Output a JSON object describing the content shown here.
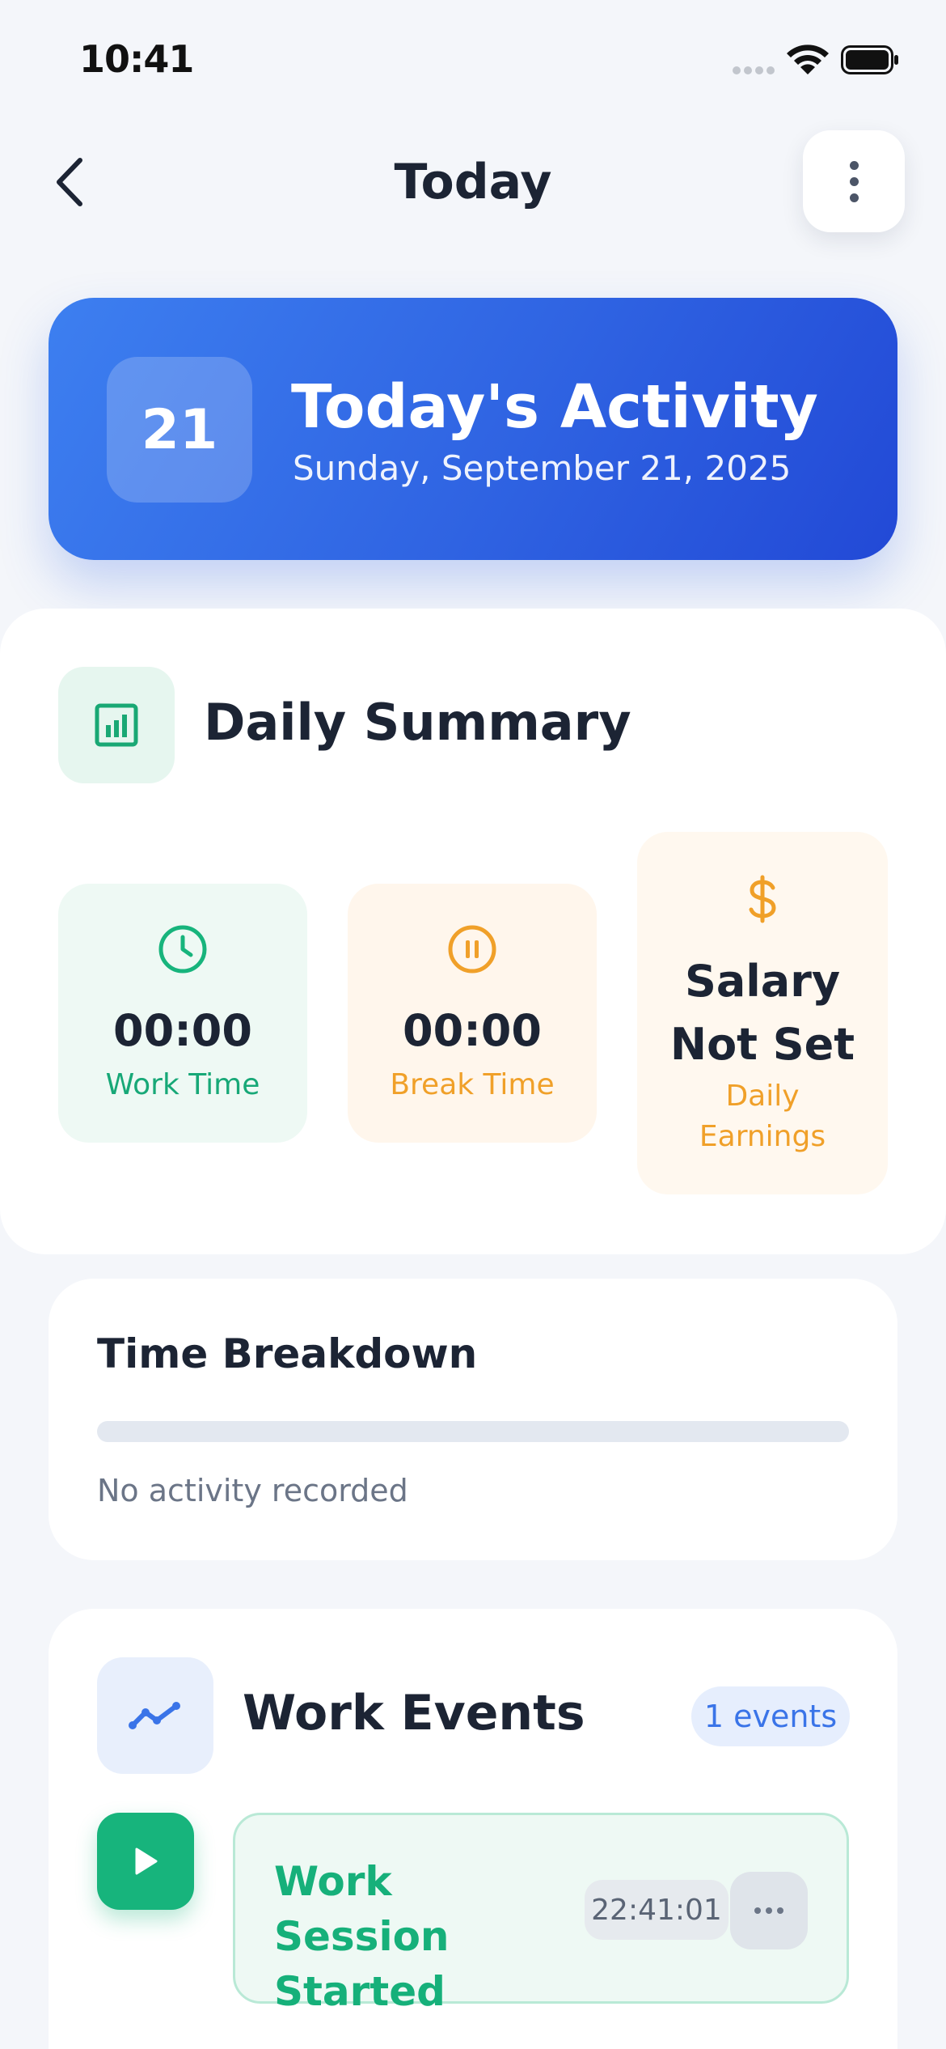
{
  "status_bar": {
    "time": "10:41"
  },
  "header": {
    "title": "Today"
  },
  "hero": {
    "day_number": "21",
    "title": "Today's Activity",
    "date": "Sunday, September 21, 2025"
  },
  "summary": {
    "title": "Daily Summary",
    "work": {
      "value": "00:00",
      "label": "Work Time"
    },
    "break": {
      "value": "00:00",
      "label": "Break Time"
    },
    "salary": {
      "value_line1": "Salary",
      "value_line2": "Not Set",
      "label_line1": "Daily",
      "label_line2": "Earnings"
    }
  },
  "breakdown": {
    "title": "Time Breakdown",
    "progress": 0,
    "empty_text": "No activity recorded"
  },
  "events": {
    "title": "Work Events",
    "badge": "1 events",
    "items": [
      {
        "title": "Work Session Started",
        "time": "22:41:01",
        "icon": "play-icon"
      }
    ]
  },
  "colors": {
    "accent_blue": "#2f63e2",
    "work_green": "#17b47c",
    "break_orange": "#f0a029",
    "text_dark": "#1c2434"
  }
}
